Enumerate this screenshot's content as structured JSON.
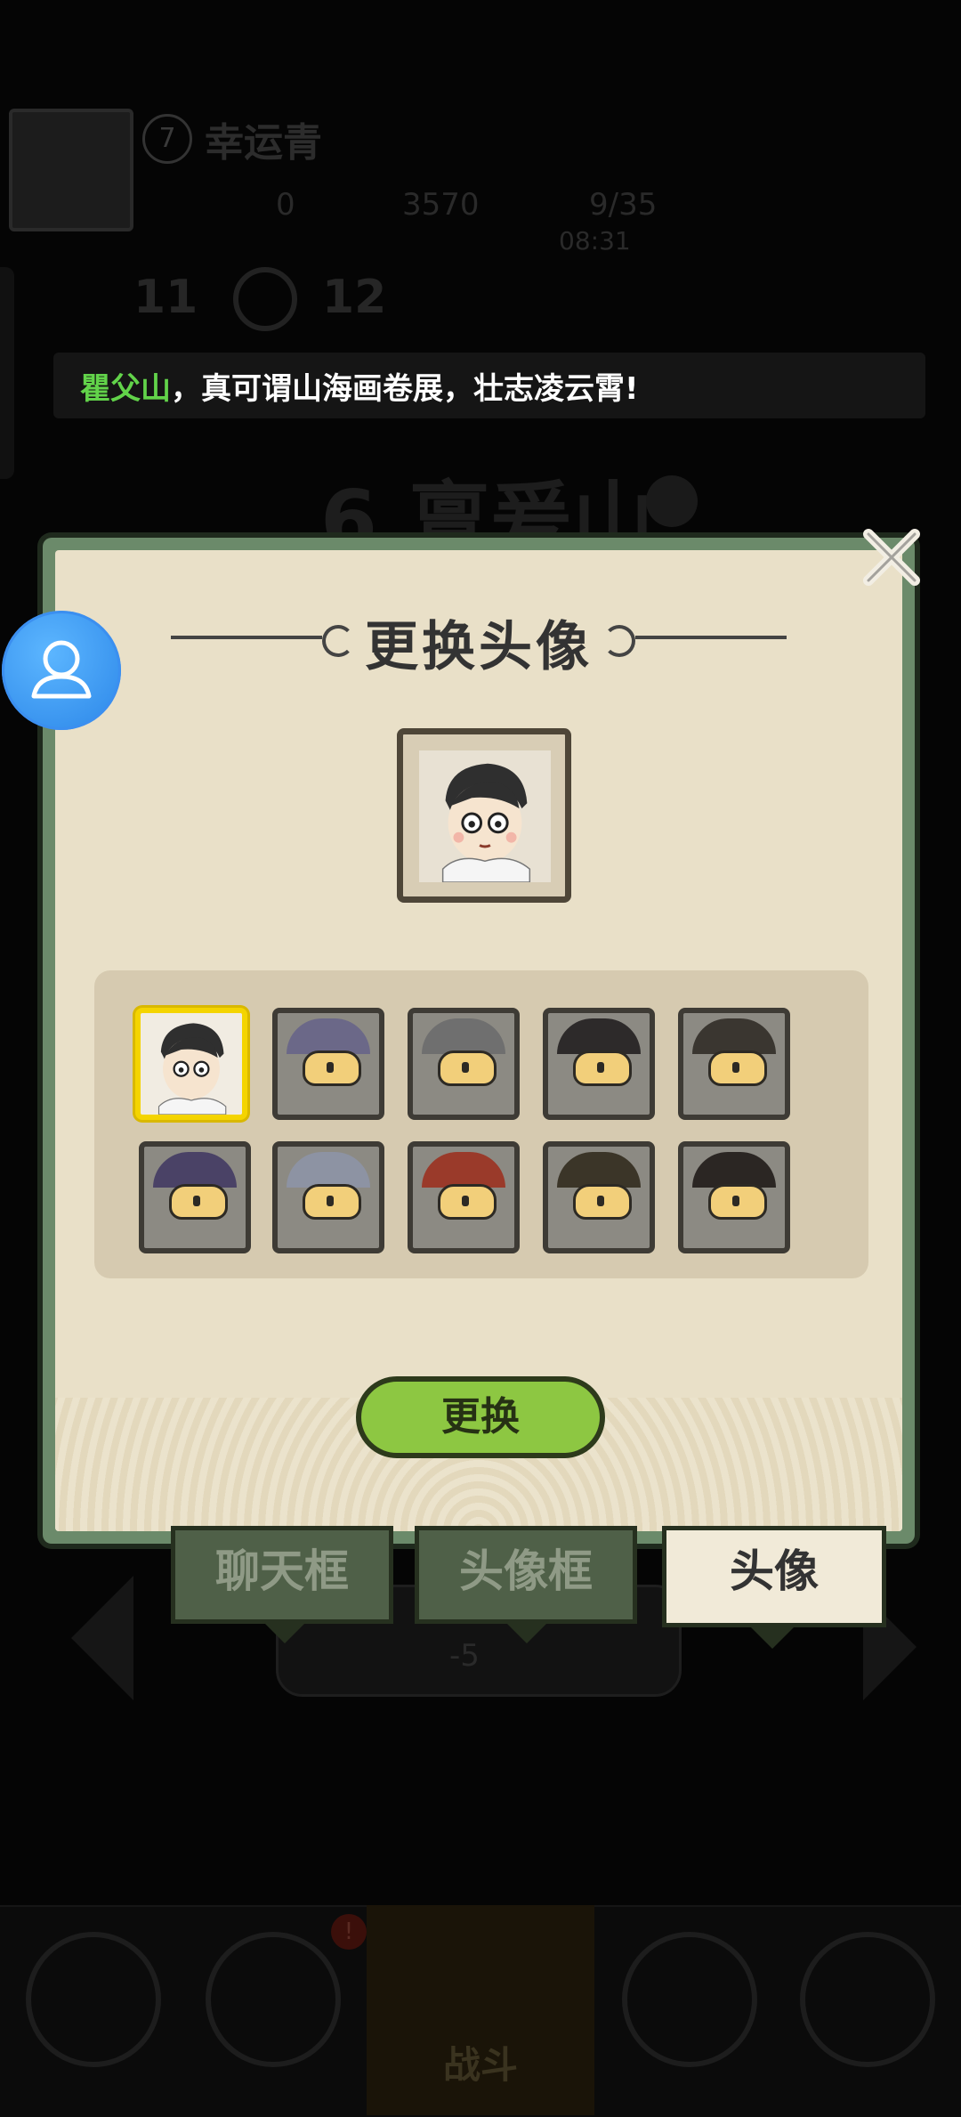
{
  "background": {
    "level": "7",
    "player_name": "幸运青",
    "resources": [
      "0",
      "3570",
      "9/35"
    ],
    "timer": "08:31",
    "stats": [
      "11",
      "12"
    ],
    "stage_title": "6.亶爰山",
    "cost": "-5"
  },
  "banner": {
    "highlight": "瞿父山",
    "text": "，真可谓山海画卷展，壮志凌云霄!"
  },
  "dialog": {
    "title": "更换头像",
    "avatars": [
      {
        "name": "avatar-scholar",
        "locked": false,
        "selected": true
      },
      {
        "name": "avatar-locked-1",
        "locked": true
      },
      {
        "name": "avatar-locked-2",
        "locked": true
      },
      {
        "name": "avatar-locked-3",
        "locked": true
      },
      {
        "name": "avatar-locked-4",
        "locked": true
      },
      {
        "name": "avatar-locked-5",
        "locked": true
      },
      {
        "name": "avatar-locked-6",
        "locked": true
      },
      {
        "name": "avatar-locked-7",
        "locked": true
      },
      {
        "name": "avatar-locked-8",
        "locked": true
      },
      {
        "name": "avatar-locked-9",
        "locked": true
      }
    ],
    "swap_button": "更换"
  },
  "tabs": [
    {
      "label": "聊天框",
      "active": false
    },
    {
      "label": "头像框",
      "active": false
    },
    {
      "label": "头像",
      "active": true
    }
  ],
  "nav": {
    "battle_label": "战斗",
    "badge": "!"
  },
  "colors": {
    "accent_green": "#8dc742",
    "highlight_green": "#62d34a",
    "selected_border": "#f4d400",
    "float_button": "#2b86e8"
  }
}
